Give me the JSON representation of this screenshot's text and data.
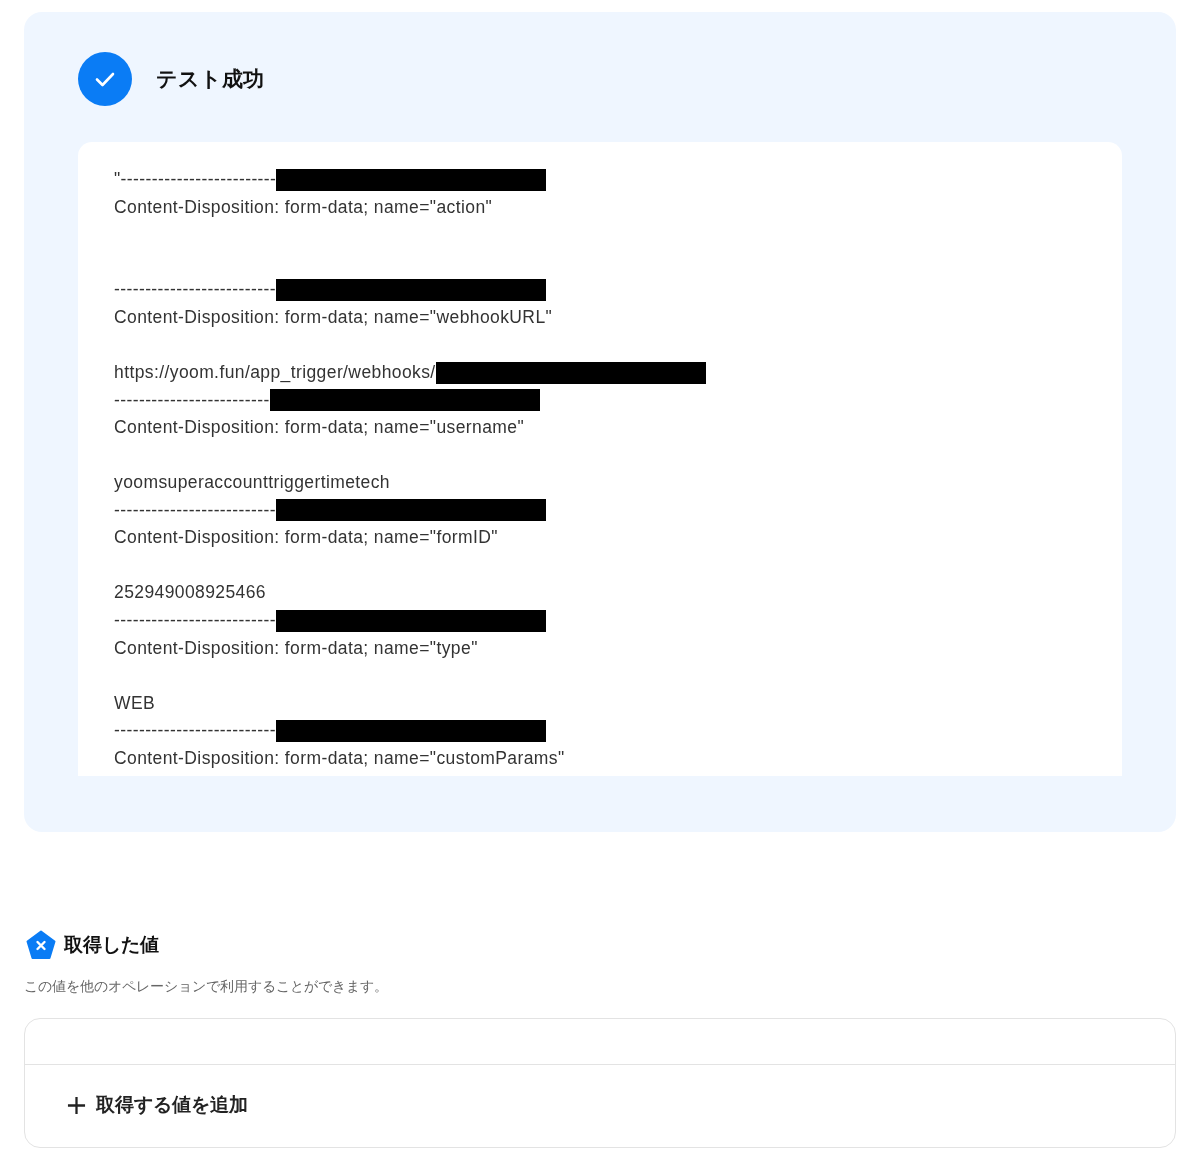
{
  "test_result": {
    "title": "テスト成功",
    "output_lines": [
      {
        "kind": "text",
        "text": "\"-------------------------",
        "redacted": true
      },
      {
        "kind": "text",
        "text": "Content-Disposition: form-data; name=\"action\"",
        "redacted": false
      },
      {
        "kind": "blank",
        "redacted": false
      },
      {
        "kind": "blank",
        "redacted": false
      },
      {
        "kind": "text",
        "text": "--------------------------",
        "redacted": true
      },
      {
        "kind": "text",
        "text": "Content-Disposition: form-data; name=\"webhookURL\"",
        "redacted": false
      },
      {
        "kind": "blank",
        "redacted": false
      },
      {
        "kind": "text",
        "text": "https://yoom.fun/app_trigger/webhooks/",
        "redacted": true
      },
      {
        "kind": "text",
        "text": "-------------------------",
        "redacted": true
      },
      {
        "kind": "text",
        "text": "Content-Disposition: form-data; name=\"username\"",
        "redacted": false
      },
      {
        "kind": "blank",
        "redacted": false
      },
      {
        "kind": "text",
        "text": "yoomsuperaccounttriggertimetech",
        "redacted": false
      },
      {
        "kind": "text",
        "text": "--------------------------",
        "redacted": true
      },
      {
        "kind": "text",
        "text": "Content-Disposition: form-data; name=\"formID\"",
        "redacted": false
      },
      {
        "kind": "blank",
        "redacted": false
      },
      {
        "kind": "text",
        "text": "252949008925466",
        "redacted": false
      },
      {
        "kind": "text",
        "text": "--------------------------",
        "redacted": true
      },
      {
        "kind": "text",
        "text": "Content-Disposition: form-data; name=\"type\"",
        "redacted": false
      },
      {
        "kind": "blank",
        "redacted": false
      },
      {
        "kind": "text",
        "text": "WEB",
        "redacted": false
      },
      {
        "kind": "text",
        "text": "--------------------------",
        "redacted": true
      },
      {
        "kind": "text",
        "text": "Content-Disposition: form-data; name=\"customParams\"",
        "redacted": false
      }
    ]
  },
  "acquired_values": {
    "title": "取得した値",
    "description": "この値を他のオペレーションで利用することができます。",
    "add_button": "取得する値を追加"
  }
}
